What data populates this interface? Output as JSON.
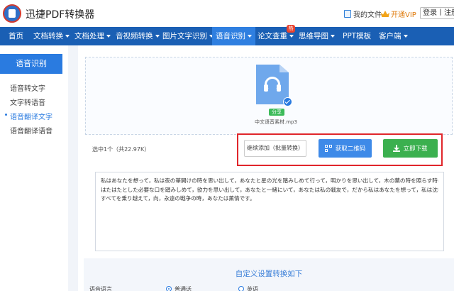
{
  "app": {
    "title": "迅捷PDF转换器"
  },
  "header": {
    "my_files": "我的文件",
    "vip": "开通VIP",
    "login": "登录丨注册"
  },
  "nav": {
    "items": [
      {
        "label": "首页",
        "has_dropdown": false
      },
      {
        "label": "文档转换",
        "has_dropdown": true
      },
      {
        "label": "文档处理",
        "has_dropdown": true
      },
      {
        "label": "音视频转换",
        "has_dropdown": true
      },
      {
        "label": "图片文字识别",
        "has_dropdown": true
      },
      {
        "label": "语音识别",
        "has_dropdown": true,
        "active": true
      },
      {
        "label": "论文查重",
        "has_dropdown": true,
        "badge": "热"
      },
      {
        "label": "思维导图",
        "has_dropdown": true
      },
      {
        "label": "PPT模板",
        "has_dropdown": false
      },
      {
        "label": "客户端",
        "has_dropdown": true
      }
    ]
  },
  "sidebar": {
    "heading": "语音识别",
    "items": [
      {
        "label": "语音转文字"
      },
      {
        "label": "文字转语音"
      },
      {
        "label": "语音翻译文字",
        "active": true
      },
      {
        "label": "语音翻译语音"
      }
    ]
  },
  "upload": {
    "file_icon": "audio-file-icon",
    "share_badge": "分享",
    "file_name": "中文语音素材.mp3",
    "selected_info": "选中1个（共22.97K）"
  },
  "actions": {
    "continue_label": "继续添加（批量转换）",
    "qr_label": "获取二维码",
    "download_label": "立即下载"
  },
  "result": {
    "lines": [
      "私はあなたを想って，私は夜の華開けの時を思い出して，あなたと星の光を踏みしめて行って，明かりを思い出して，木の葉の時を照らす時に",
      "はたはたとした必要な口を踏みしめて，欲力を思い出して，あなたと一緒にいて，あなたは私の戦友で，だから私はあなたを想って，私は沈む",
      "すべてを乗り越えて，向，永遠の戦争の時，あなたは薫情です。"
    ]
  },
  "settings": {
    "title": "自定义设置转换如下",
    "row_label": "语音语言",
    "options": [
      "普通话",
      "英语"
    ]
  },
  "colors": {
    "brand": "#1a5fb4",
    "accent": "#2a7be0",
    "download": "#3bb04f",
    "highlight": "#e0262b"
  }
}
